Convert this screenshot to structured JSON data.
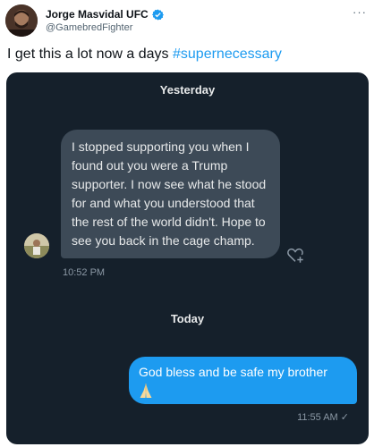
{
  "tweet": {
    "display_name": "Jorge Masvidal UFC",
    "handle": "@GamebredFighter",
    "text_before": "I get this a lot now a days ",
    "hashtag": "#supernecessary",
    "more_glyph": "···"
  },
  "dm": {
    "sep_yesterday": "Yesterday",
    "incoming_message": "I stopped supporting you when I found out you were a Trump supporter. I now see what he stood for and what you understood that the rest of the world didn't. Hope to see you back in the cage champ.",
    "incoming_time": "10:52 PM",
    "sep_today": "Today",
    "outgoing_message": "God bless and be safe my brother",
    "outgoing_time": "11:55 AM ✓"
  },
  "colors": {
    "accent": "#1d9bf0",
    "dm_background": "#15202b",
    "incoming_bubble": "#3d4a57"
  }
}
